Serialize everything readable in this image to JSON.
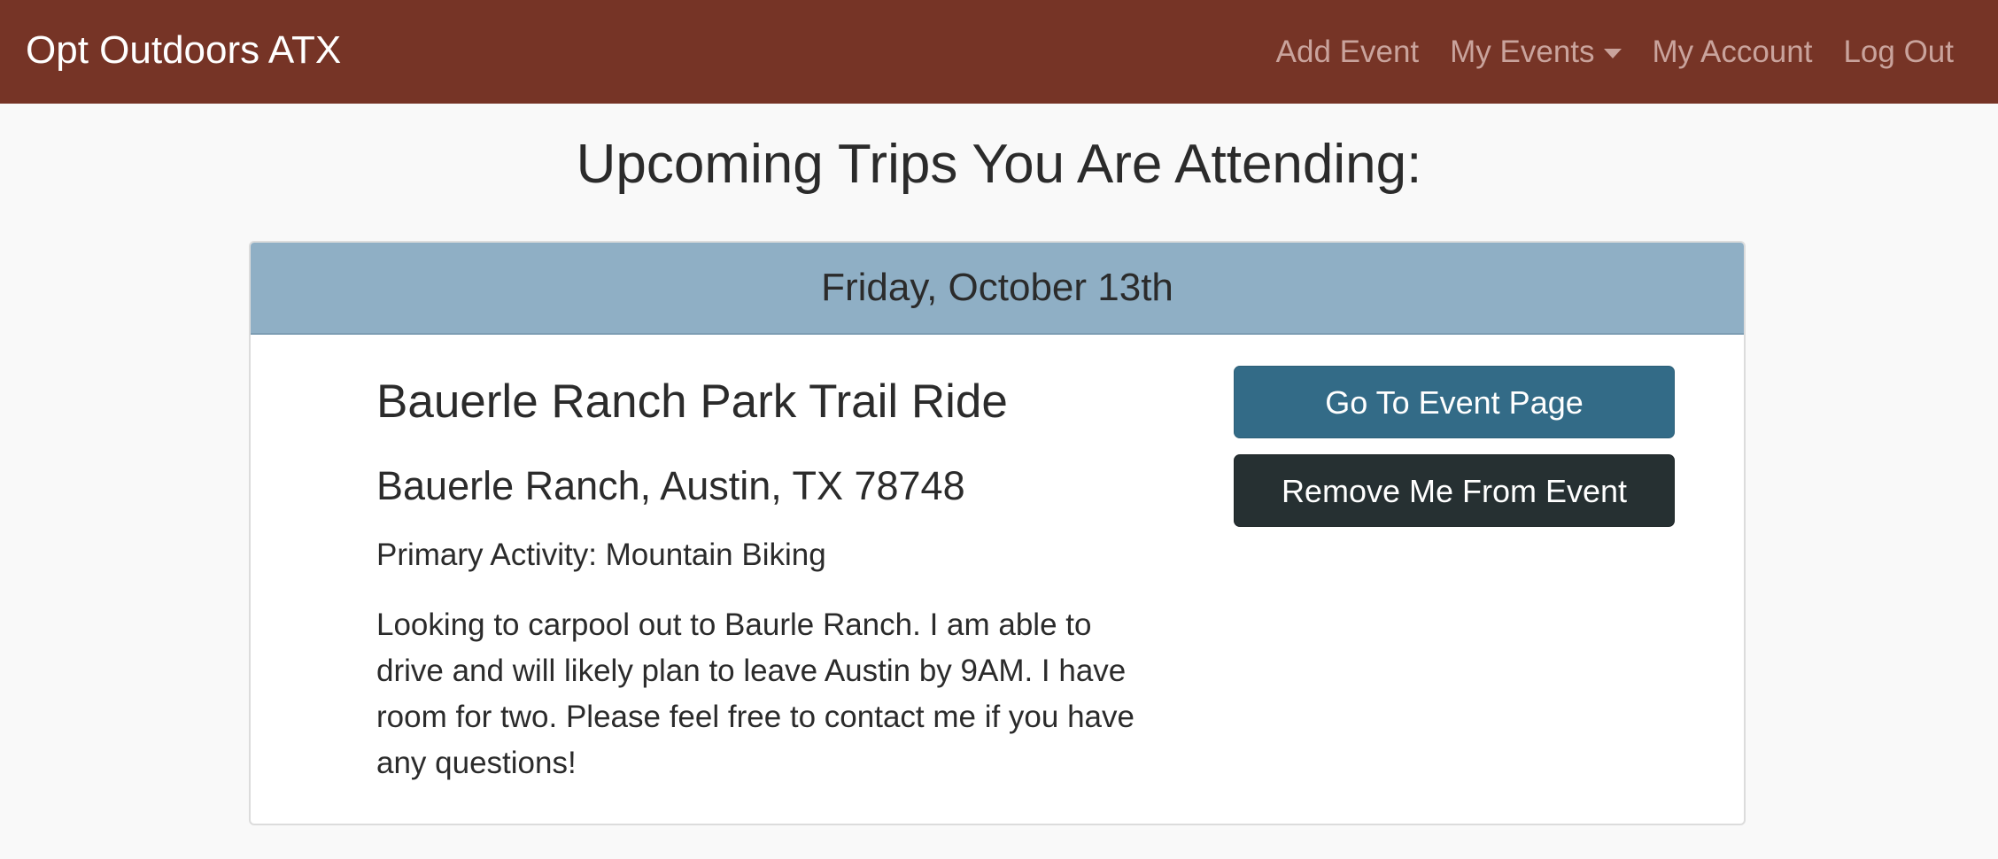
{
  "navbar": {
    "brand": "Opt Outdoors ATX",
    "links": {
      "add_event": "Add Event",
      "my_events": "My Events",
      "my_account": "My Account",
      "log_out": "Log Out"
    },
    "colors": {
      "background": "#763426",
      "link": "#c9a39c",
      "brand": "#ffffff"
    }
  },
  "page": {
    "title": "Upcoming Trips You Are Attending:"
  },
  "event_card": {
    "date_header": "Friday, October 13th",
    "name": "Bauerle Ranch Park Trail Ride",
    "location": "Bauerle Ranch, Austin, TX 78748",
    "activity": "Primary Activity: Mountain Biking",
    "description": "Looking to carpool out to Baurle Ranch. I am able to drive and will likely plan to leave Austin by 9AM. I have room for two. Please feel free to contact me if you have any questions!",
    "buttons": {
      "go_to_event": "Go To Event Page",
      "remove_me": "Remove Me From Event"
    },
    "colors": {
      "header": "#8fafc5",
      "primary_button": "#336b87",
      "dark_button": "#263032"
    }
  }
}
